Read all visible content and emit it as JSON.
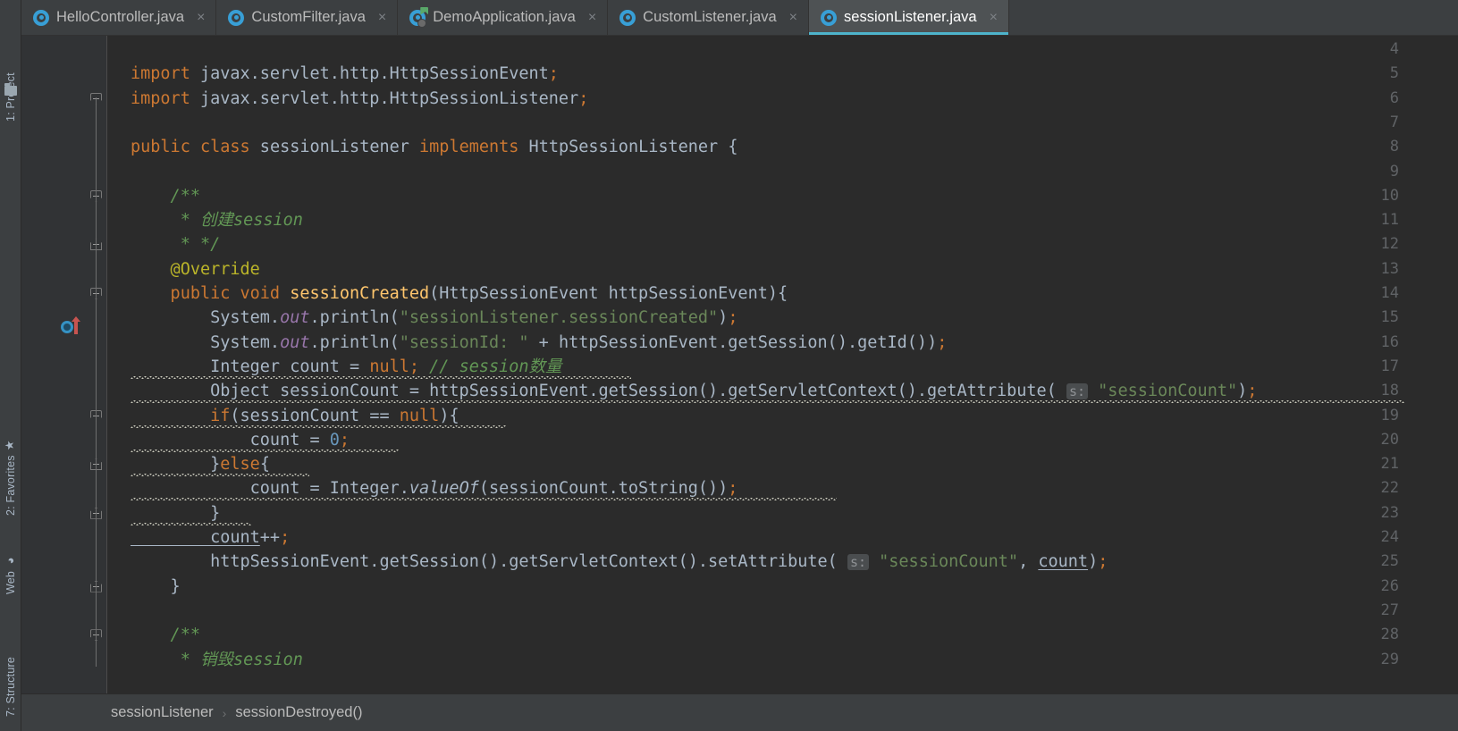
{
  "window": {
    "background": "#3c3f41",
    "editor_background": "#2b2b2b",
    "gutter_background": "#313335",
    "accent": "#4eb4cc"
  },
  "left_strip": {
    "tabs": [
      {
        "label": "1: Project",
        "icon": "folder-icon"
      },
      {
        "label": "2: Favorites",
        "icon": "star-icon",
        "glyph": "★"
      },
      {
        "label": "Web",
        "icon": "globe-icon",
        "glyph": "◕"
      },
      {
        "label": "7: Structure",
        "icon": "structure-icon"
      }
    ]
  },
  "tabs": [
    {
      "label": "HelloController.java",
      "icon": "java-class-icon",
      "active": false,
      "close": "×"
    },
    {
      "label": "CustomFilter.java",
      "icon": "java-class-icon",
      "active": false,
      "close": "×"
    },
    {
      "label": "DemoApplication.java",
      "icon": "java-runnable-class-icon",
      "active": false,
      "close": "×"
    },
    {
      "label": "CustomListener.java",
      "icon": "java-class-icon",
      "active": false,
      "close": "×"
    },
    {
      "label": "sessionListener.java",
      "icon": "java-class-icon",
      "active": true,
      "close": "×"
    }
  ],
  "editor": {
    "first_line": 4,
    "last_line": 29,
    "line_numbers": [
      4,
      5,
      6,
      7,
      8,
      9,
      10,
      11,
      12,
      13,
      14,
      15,
      16,
      17,
      18,
      19,
      20,
      21,
      22,
      23,
      24,
      25,
      26,
      27,
      28,
      29
    ],
    "override_marker_line": 14,
    "lines": [
      {
        "n": 4,
        "text": ""
      },
      {
        "n": 5,
        "text": "import javax.servlet.http.HttpSessionEvent;"
      },
      {
        "n": 6,
        "text": "import javax.servlet.http.HttpSessionListener;"
      },
      {
        "n": 7,
        "text": ""
      },
      {
        "n": 8,
        "text": "public class sessionListener implements HttpSessionListener {"
      },
      {
        "n": 9,
        "text": ""
      },
      {
        "n": 10,
        "text": "    /**"
      },
      {
        "n": 11,
        "text": "     * 创建session"
      },
      {
        "n": 12,
        "text": "     * */"
      },
      {
        "n": 13,
        "text": "    @Override"
      },
      {
        "n": 14,
        "text": "    public void sessionCreated(HttpSessionEvent httpSessionEvent){"
      },
      {
        "n": 15,
        "text": "        System.out.println(\"sessionListener.sessionCreated\");"
      },
      {
        "n": 16,
        "text": "        System.out.println(\"sessionId: \" + httpSessionEvent.getSession().getId());"
      },
      {
        "n": 17,
        "text": "        Integer count = null; // session数量"
      },
      {
        "n": 18,
        "text": "        Object sessionCount = httpSessionEvent.getSession().getServletContext().getAttribute( s: \"sessionCount\");"
      },
      {
        "n": 19,
        "text": "        if(sessionCount == null){"
      },
      {
        "n": 20,
        "text": "            count = 0;"
      },
      {
        "n": 21,
        "text": "        }else{"
      },
      {
        "n": 22,
        "text": "            count = Integer.valueOf(sessionCount.toString());"
      },
      {
        "n": 23,
        "text": "        }"
      },
      {
        "n": 24,
        "text": "        count++;"
      },
      {
        "n": 25,
        "text": "        httpSessionEvent.getSession().getServletContext().setAttribute( s: \"sessionCount\", count);"
      },
      {
        "n": 26,
        "text": "    }"
      },
      {
        "n": 27,
        "text": ""
      },
      {
        "n": 28,
        "text": "    /**"
      },
      {
        "n": 29,
        "text": "     * 销毁session"
      }
    ],
    "inlay_hints": [
      {
        "line": 18,
        "text": "s:"
      },
      {
        "line": 25,
        "text": "s:"
      }
    ],
    "syntax_colors": {
      "keyword": "#cc7832",
      "string": "#6a8759",
      "comment": "#629755",
      "number": "#6897bb",
      "annotation": "#bbb529",
      "method": "#ffc66d",
      "static_field": "#9876aa",
      "default_text": "#a9b7c6"
    },
    "tokens": {
      "l5": [
        [
          "kw",
          "import"
        ],
        [
          "plain",
          " javax.servlet.http.HttpSessionEvent"
        ],
        [
          "semi",
          ";"
        ]
      ],
      "l6": [
        [
          "kw",
          "import"
        ],
        [
          "plain",
          " javax.servlet.http.HttpSessionListener"
        ],
        [
          "semi",
          ";"
        ]
      ],
      "l8": [
        [
          "kw",
          "public"
        ],
        [
          "plain",
          " "
        ],
        [
          "kw",
          "class"
        ],
        [
          "plain",
          " sessionListener "
        ],
        [
          "kw",
          "implements"
        ],
        [
          "plain",
          " HttpSessionListener {"
        ]
      ],
      "l10": [
        [
          "cmt",
          "    /**"
        ]
      ],
      "l11": [
        [
          "cmt",
          "     * 创建session"
        ]
      ],
      "l12": [
        [
          "cmt",
          "     * */"
        ]
      ],
      "l13": [
        [
          "ann",
          "    @Override"
        ]
      ],
      "l14": [
        [
          "kw",
          "    public void"
        ],
        [
          "fn",
          " sessionCreated"
        ],
        [
          "plain",
          "(HttpSessionEvent httpSessionEvent){"
        ]
      ],
      "l15": [
        [
          "plain",
          "        System."
        ],
        [
          "stat",
          "out"
        ],
        [
          "plain",
          ".println("
        ],
        [
          "str",
          "\"sessionListener.sessionCreated\""
        ],
        [
          "plain",
          ")"
        ],
        [
          "semi",
          ";"
        ]
      ],
      "l16": [
        [
          "plain",
          "        System."
        ],
        [
          "stat",
          "out"
        ],
        [
          "plain",
          ".println("
        ],
        [
          "str",
          "\"sessionId: \""
        ],
        [
          "plain",
          " + httpSessionEvent.getSession().getId())"
        ],
        [
          "semi",
          ";"
        ]
      ],
      "l17": [
        [
          "plain",
          "        Integer count = "
        ],
        [
          "kw",
          "null"
        ],
        [
          "semi",
          ";"
        ],
        [
          "cmt",
          " // session数量"
        ]
      ],
      "l18": [
        [
          "plain",
          "        Object sessionCount = httpSessionEvent.getSession().getServletContext().getAttribute( "
        ],
        [
          "hint",
          "s:"
        ],
        [
          "plain",
          " "
        ],
        [
          "str",
          "\"sessionCount\""
        ],
        [
          "plain",
          ")"
        ],
        [
          "semi",
          ";"
        ]
      ],
      "l19": [
        [
          "kw",
          "        if"
        ],
        [
          "plain",
          "(sessionCount == "
        ],
        [
          "kw",
          "null"
        ],
        [
          "plain",
          "){"
        ]
      ],
      "l20": [
        [
          "plain",
          "            count = "
        ],
        [
          "num",
          "0"
        ],
        [
          "semi",
          ";"
        ]
      ],
      "l21": [
        [
          "plain",
          "        }"
        ],
        [
          "kw",
          "else"
        ],
        [
          "plain",
          "{"
        ]
      ],
      "l22": [
        [
          "plain",
          "            count = Integer."
        ],
        [
          "italmeth",
          "valueOf"
        ],
        [
          "plain",
          "(sessionCount.toString())"
        ],
        [
          "semi",
          ";"
        ]
      ],
      "l23": [
        [
          "plain",
          "        }"
        ]
      ],
      "l24": [
        [
          "underline",
          "        count"
        ],
        [
          "plain",
          "++"
        ],
        [
          "semi",
          ";"
        ]
      ],
      "l25": [
        [
          "plain",
          "        httpSessionEvent.getSession().getServletContext().setAttribute( "
        ],
        [
          "hint",
          "s:"
        ],
        [
          "plain",
          " "
        ],
        [
          "str",
          "\"sessionCount\""
        ],
        [
          "plain",
          ", "
        ],
        [
          "underline",
          "count"
        ],
        [
          "plain",
          ")"
        ],
        [
          "semi",
          ";"
        ]
      ],
      "l26": [
        [
          "plain",
          "    }"
        ]
      ],
      "l28": [
        [
          "cmt",
          "    /**"
        ]
      ],
      "l29": [
        [
          "cmt",
          "     * 销毁session"
        ]
      ]
    },
    "warning_underline_lines": [
      17,
      18,
      19,
      20,
      21,
      22,
      23
    ]
  },
  "breadcrumb": {
    "items": [
      "sessionListener",
      "sessionDestroyed()"
    ],
    "separator": "›"
  }
}
